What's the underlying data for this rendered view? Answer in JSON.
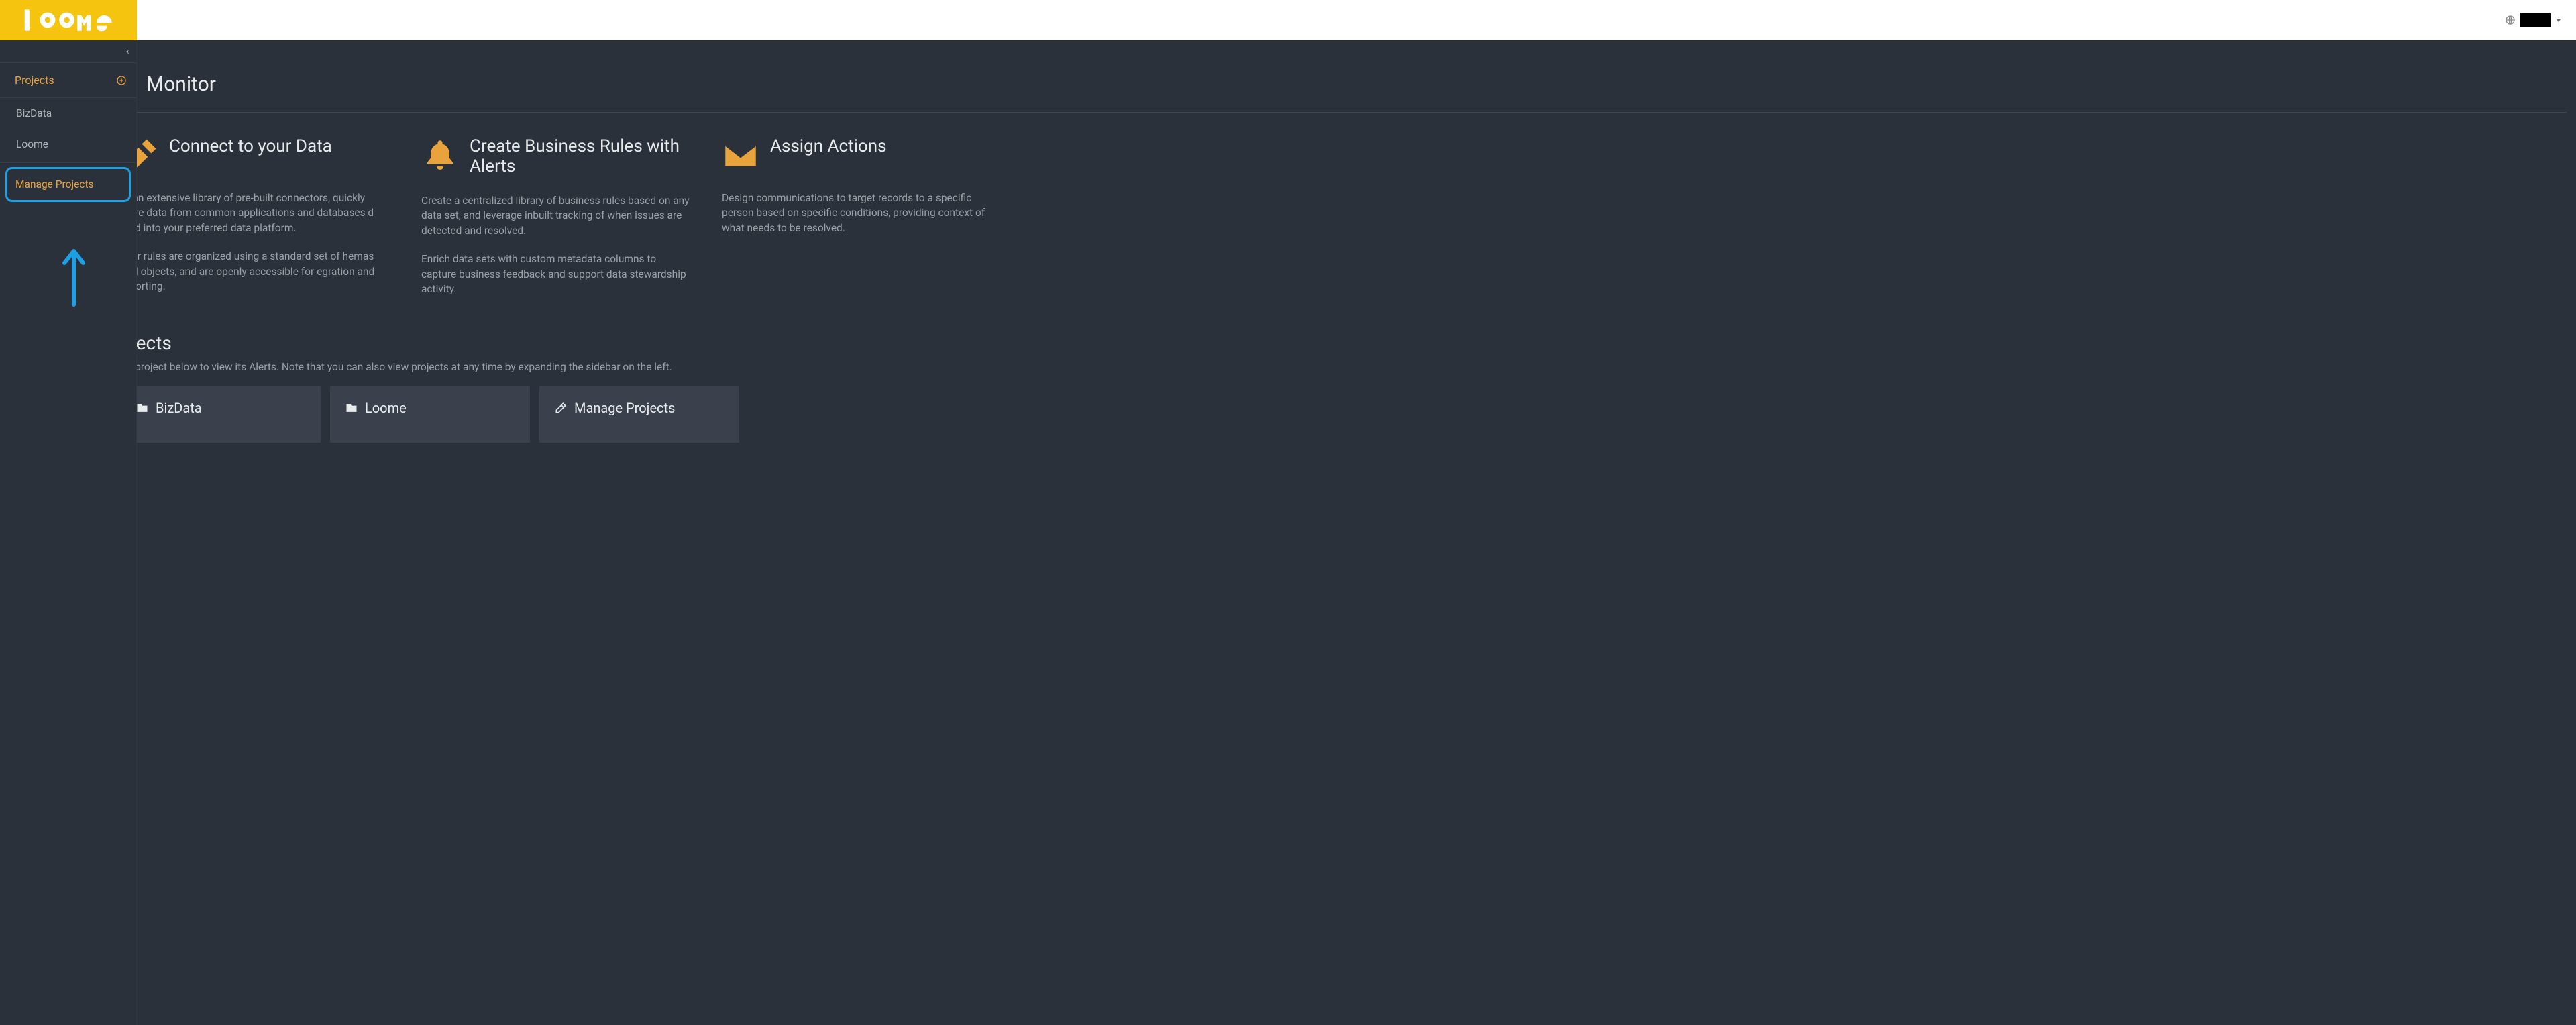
{
  "colors": {
    "accent": "#f5c40f",
    "orange": "#e8a33c",
    "highlight_border": "#1ea0e6",
    "panel": "#2b313b",
    "card": "#3a414d"
  },
  "logo_text": "loome",
  "topbar": {
    "user_label": ""
  },
  "sidebar": {
    "header": "Projects",
    "items": [
      {
        "label": "BizData"
      },
      {
        "label": "Loome"
      },
      {
        "label": "Manage Projects"
      }
    ]
  },
  "page": {
    "title_visible_fragment": "Monitor"
  },
  "features": [
    {
      "icon": "plug",
      "title": "Connect to your Data",
      "body": [
        "th an extensive library of pre-built connectors, quickly quire data from common applications and databases d load into your preferred data platform.",
        "your rules are organized using a standard set of hemas and objects, and are openly accessible for egration and reporting."
      ]
    },
    {
      "icon": "bell",
      "title": "Create Business Rules with Alerts",
      "body": [
        "Create a centralized library of business rules based on any data set, and leverage inbuilt tracking of when issues are detected and resolved.",
        "Enrich data sets with custom metadata columns to capture business feedback and support data stewardship activity."
      ]
    },
    {
      "icon": "envelope",
      "title": "Assign Actions",
      "body": [
        "Design communications to target records to a specific person based on specific conditions, providing context of what needs to be resolved."
      ]
    }
  ],
  "projects": {
    "heading_visible_fragment": "ojects",
    "subtext_visible_fragment": "t a project below to view its Alerts. Note that you can also view projects at any time by expanding the sidebar on the left.",
    "cards": [
      {
        "icon": "folder",
        "label": "BizData"
      },
      {
        "icon": "folder",
        "label": "Loome"
      },
      {
        "icon": "edit",
        "label": "Manage Projects"
      }
    ]
  }
}
